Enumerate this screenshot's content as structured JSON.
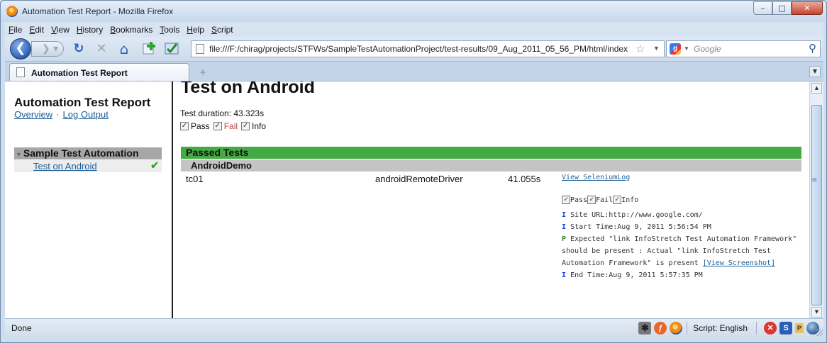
{
  "window": {
    "title": "Automation Test Report - Mozilla Firefox",
    "buttons": {
      "minimize": "–",
      "maximize": "□",
      "close": "✕"
    }
  },
  "menubar": {
    "items": [
      {
        "label": "File"
      },
      {
        "label": "Edit"
      },
      {
        "label": "View"
      },
      {
        "label": "History"
      },
      {
        "label": "Bookmarks"
      },
      {
        "label": "Tools"
      },
      {
        "label": "Help"
      },
      {
        "label": "Script"
      }
    ]
  },
  "navbar": {
    "back_glyph": "❮",
    "forward_glyph": "❯ ▾",
    "reload_glyph": "↻",
    "stop_glyph": "✕",
    "home_glyph": "⌂",
    "url": "file:///F:/chirag/projects/STFWs/SampleTestAutomationProject/test-results/09_Aug_2011_05_56_PM/html/index",
    "search_placeholder": "Google"
  },
  "tabs": {
    "active_label": "Automation Test Report",
    "new_tab_glyph": "+"
  },
  "sidebar": {
    "title": "Automation Test Report",
    "links": {
      "overview": "Overview",
      "separator": "·",
      "log_output": "Log Output"
    },
    "suite": {
      "name": "Sample Test Automation",
      "item": "Test on Android",
      "item_status": "✔"
    }
  },
  "main": {
    "title": "Test on Android",
    "duration": "Test duration: 43.323s",
    "filters": {
      "pass": "Pass",
      "fail": "Fail",
      "info": "Info"
    },
    "passed_header": "Passed Tests",
    "class_name": "AndroidDemo",
    "test_row": {
      "name": "tc01",
      "driver": "androidRemoteDriver",
      "time": "41.055s",
      "log_link": "View SeleniumLog"
    },
    "log_filters": {
      "pass": "Pass",
      "fail": "Fail",
      "info": "Info"
    },
    "log_lines": [
      {
        "marker": "I",
        "text": "Site URL:http://www.google.com/"
      },
      {
        "marker": "I",
        "text": "Start Time:Aug 9, 2011 5:56:54 PM"
      },
      {
        "marker": "P",
        "text": "Expected \"link InfoStretch Test Automation Framework\" should be present : Actual \"link InfoStretch Test Automation Framework\" is present",
        "link": "[View Screenshot]"
      },
      {
        "marker": "I",
        "text": "End Time:Aug 9, 2011 5:57:35 PM"
      }
    ]
  },
  "statusbar": {
    "text": "Done",
    "script_language": "Script: English"
  },
  "colors": {
    "passed_bar": "#44aa44",
    "class_bar": "#c4c4c4",
    "link": "#1a5d96",
    "info_marker": "#1a3fd0",
    "pass_marker": "#2a8a2a"
  }
}
